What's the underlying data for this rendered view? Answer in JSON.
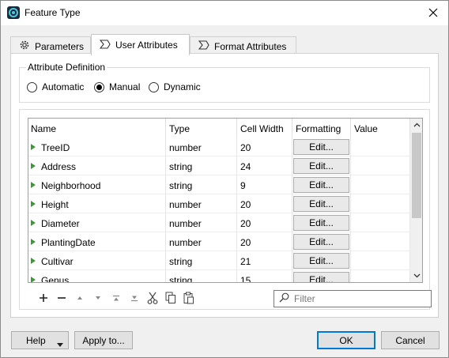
{
  "window": {
    "title": "Feature Type",
    "close_symbol": "✕"
  },
  "tabs": [
    {
      "label": "Parameters",
      "icon": "gear-icon"
    },
    {
      "label": "User Attributes",
      "icon": "sigma-icon"
    },
    {
      "label": "Format Attributes",
      "icon": "sigma-icon"
    }
  ],
  "attribute_definition": {
    "label": "Attribute Definition",
    "options": [
      {
        "label": "Automatic",
        "selected": false
      },
      {
        "label": "Manual",
        "selected": true
      },
      {
        "label": "Dynamic",
        "selected": false
      }
    ]
  },
  "table": {
    "columns": [
      "Name",
      "Type",
      "Cell Width",
      "Formatting",
      "Value"
    ],
    "edit_label": "Edit...",
    "rows": [
      {
        "name": "TreeID",
        "type": "number",
        "width": "20",
        "value": ""
      },
      {
        "name": "Address",
        "type": "string",
        "width": "24",
        "value": ""
      },
      {
        "name": "Neighborhood",
        "type": "string",
        "width": "9",
        "value": ""
      },
      {
        "name": "Height",
        "type": "number",
        "width": "20",
        "value": ""
      },
      {
        "name": "Diameter",
        "type": "number",
        "width": "20",
        "value": ""
      },
      {
        "name": "PlantingDate",
        "type": "number",
        "width": "20",
        "value": ""
      },
      {
        "name": "Cultivar",
        "type": "string",
        "width": "21",
        "value": ""
      },
      {
        "name": "Genus",
        "type": "string",
        "width": "15",
        "value": ""
      }
    ]
  },
  "toolbar": {
    "icons": [
      "add-icon",
      "remove-icon",
      "move-up-icon",
      "move-down-icon",
      "move-top-icon",
      "move-bottom-icon",
      "cut-icon",
      "copy-icon",
      "paste-icon"
    ]
  },
  "filter": {
    "placeholder": "Filter",
    "value": ""
  },
  "buttons": {
    "help": "Help",
    "apply": "Apply to...",
    "ok": "OK",
    "cancel": "Cancel"
  },
  "colors": {
    "accent": "#0078d7",
    "expand_arrow": "#3a9a3a"
  }
}
